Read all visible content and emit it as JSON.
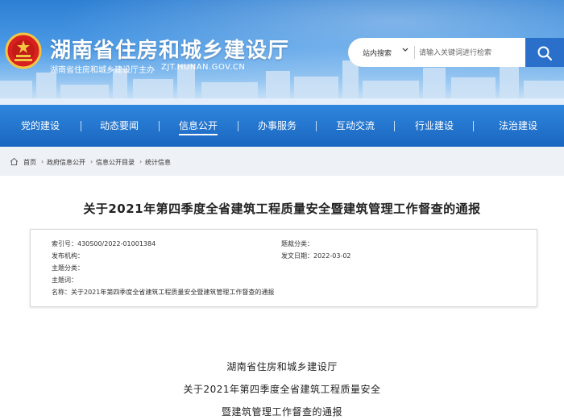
{
  "header": {
    "title": "湖南省住房和城乡建设厅",
    "subtitle": "湖南省住房和城乡建设厅主办",
    "domain": "ZJT.HUNAN.GOV.CN",
    "colors": {
      "sky_top": "#2d7fd3",
      "nav": "#1a66c0",
      "search_button": "#2a6fc9"
    }
  },
  "search": {
    "type_label": "站内搜索",
    "placeholder": "请输入关键词进行检索",
    "icons": {
      "dropdown": "chevron-down-icon",
      "submit": "search-icon"
    }
  },
  "nav": {
    "items": [
      {
        "label": "党的建设"
      },
      {
        "label": "动态要闻"
      },
      {
        "label": "信息公开",
        "active": true
      },
      {
        "label": "办事服务"
      },
      {
        "label": "互动交流"
      },
      {
        "label": "行业建设"
      },
      {
        "label": "法治建设"
      }
    ]
  },
  "breadcrumb": {
    "home_icon": "home-icon",
    "items": [
      "首页",
      "政府信息公开",
      "信息公开目录",
      "统计信息"
    ],
    "separator": "›"
  },
  "article": {
    "title": "关于2021年第四季度全省建筑工程质量安全暨建筑管理工作督查的通报",
    "meta": {
      "index_label": "索引号：",
      "index_value": "430S00/2022-01001384",
      "topic_class_label": "题裁分类：",
      "topic_class_value": "",
      "publisher_label": "发布机构：",
      "publisher_value": "",
      "date_label": "发文日期：",
      "date_value": "2022-03-02",
      "subject_class_label": "主题分类：",
      "subject_class_value": "",
      "keywords_label": "主题词：",
      "keywords_value": "",
      "name_label": "名称：",
      "name_value": "关于2021年第四季度全省建筑工程质量安全暨建筑管理工作督查的通报"
    },
    "body_lines": [
      "湖南省住房和城乡建设厅",
      "关于2021年第四季度全省建筑工程质量安全",
      "暨建筑管理工作督查的通报"
    ]
  }
}
